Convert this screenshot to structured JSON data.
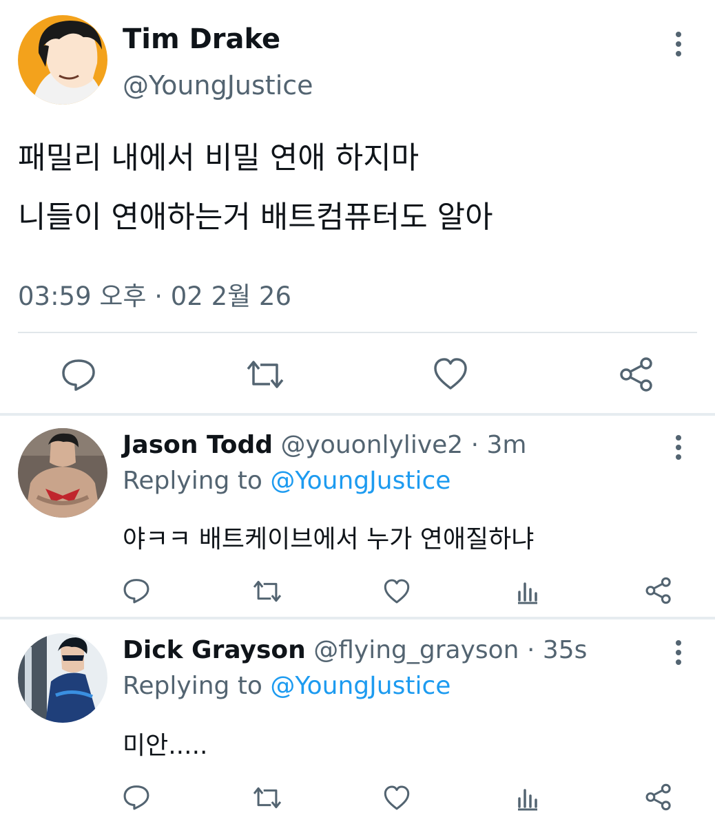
{
  "main_tweet": {
    "author_name": "Tim Drake",
    "author_handle": "@YoungJustice",
    "text_lines": [
      "패밀리 내에서 비밀 연애 하지마",
      "니들이 연애하는거 배트컴퓨터도 알아"
    ],
    "timestamp": "03:59 오후 · 02 2월 26",
    "actions": [
      "reply-icon",
      "retweet-icon",
      "like-icon",
      "share-icon"
    ]
  },
  "replies": [
    {
      "author_name": "Jason Todd",
      "author_handle": "@youonlylive2",
      "time": "· 3m",
      "replying_prefix": "Replying to",
      "replying_to": "@YoungJustice",
      "text": "야ㅋㅋ 배트케이브에서 누가 연애질하냐"
    },
    {
      "author_name": "Dick Grayson",
      "author_handle": "@flying_grayson",
      "time": "· 35s",
      "replying_prefix": "Replying to",
      "replying_to": "@YoungJustice",
      "text": "미안....."
    }
  ],
  "colors": {
    "text": "#0f1419",
    "muted": "#536471",
    "mention": "#1d9bf0",
    "divider": "#e1e6ea"
  }
}
